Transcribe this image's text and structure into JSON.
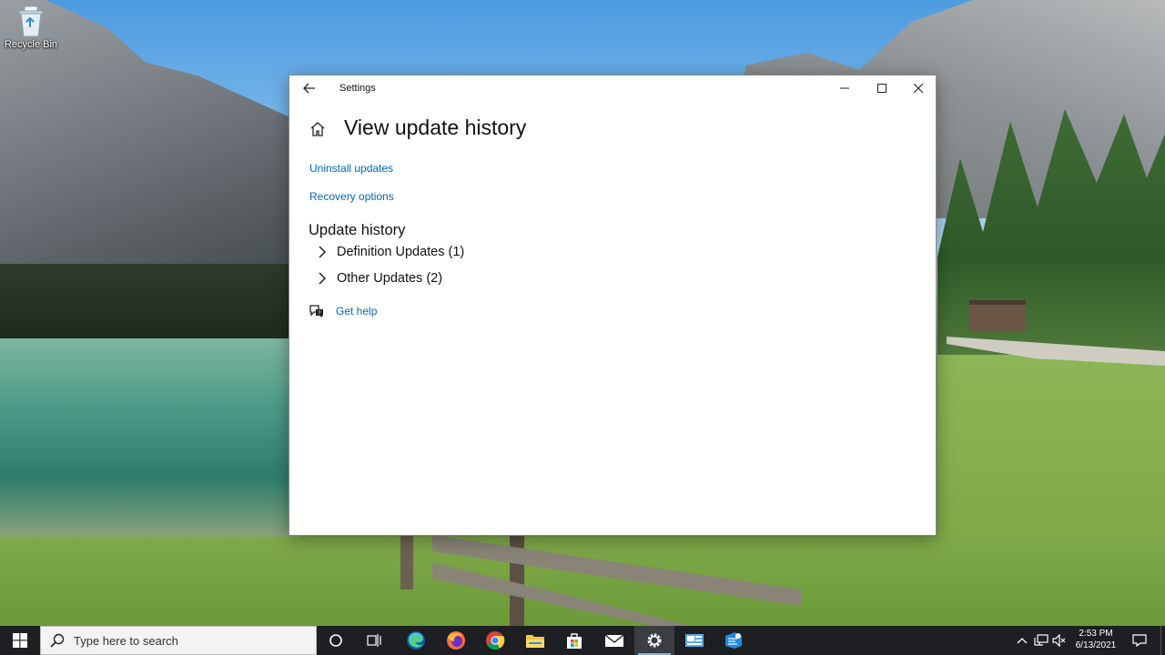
{
  "desktop": {
    "recycle_bin_label": "Recycle Bin"
  },
  "window": {
    "title": "Settings",
    "icons": {
      "back": "back-arrow-icon",
      "minimize": "minimize-icon",
      "maximize": "maximize-icon",
      "close": "close-icon",
      "home": "home-icon"
    },
    "page_title": "View update history",
    "links": {
      "uninstall": "Uninstall updates",
      "recovery": "Recovery options"
    },
    "section_title": "Update history",
    "groups": [
      {
        "label": "Definition Updates (1)",
        "expanded": false
      },
      {
        "label": "Other Updates (2)",
        "expanded": false
      }
    ],
    "help_label": "Get help",
    "accent_color": "#0067b8"
  },
  "taskbar": {
    "search_placeholder": "Type here to search",
    "apps": [
      "cortana-icon",
      "task-view-icon",
      "edge-icon",
      "firefox-icon",
      "chrome-icon",
      "file-explorer-icon",
      "store-icon",
      "mail-icon",
      "settings-icon",
      "app-icon",
      "azure-data-studio-icon"
    ],
    "active_app": "settings-icon",
    "clock": {
      "time": "2:53 PM",
      "date": "6/13/2021"
    }
  }
}
